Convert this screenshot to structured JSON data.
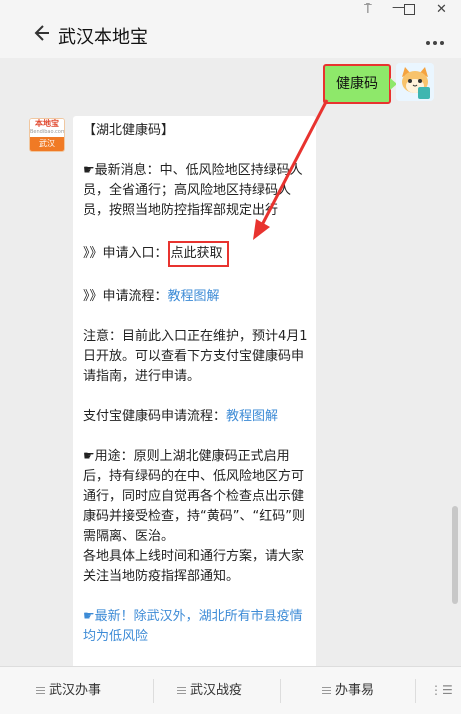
{
  "window": {
    "pin_glyph": "⍑",
    "min_glyph": "—",
    "close_glyph": "✕"
  },
  "header": {
    "back_icon": "back-arrow-icon",
    "title": "武汉本地宝",
    "more_icon": "more-dots-icon"
  },
  "chat": {
    "outgoing": {
      "text": "健康码"
    },
    "publisher_logo": {
      "top": "本地宝",
      "sub": "Bendibao.com",
      "bottom": "武汉"
    },
    "incoming": {
      "title": "【湖北健康码】",
      "news": "☛最新消息：中、低风险地区持绿码人员，全省通行；高风险地区持绿码人员，按照当地防控指挥部规定出行",
      "apply_prefix": "》》申请入口：",
      "apply_link": "点此获取",
      "process_prefix": "》》申请流程：",
      "process_link": "教程图解",
      "notice": "注意：目前此入口正在维护，预计4月1日开放。可以查看下方支付宝健康码申请指南，进行申请。",
      "alipay_prefix": "支付宝健康码申请流程：",
      "alipay_link": "教程图解",
      "usage": "☛用途：原则上湖北健康码正式启用后，持有绿码的在中、低风险地区方可通行，同时应自觉再各个检查点出示健康码并接受检查，持“黄码”、“红码”则需隔离、医治。",
      "schedule": "各地具体上线时间和通行方案，请大家关注当地防疫指挥部通知。",
      "latest_link": "☛最新！除武汉外，湖北所有市县疫情均为低风险",
      "tail": "【"
    }
  },
  "bottom_menu": {
    "items": [
      "武汉办事",
      "武汉战疫",
      "办事易"
    ],
    "keyboard_icon": "keyboard-toggle-icon",
    "keyboard_glyph": "⋮☰"
  },
  "colors": {
    "bubble_green": "#8ee86a",
    "annotation_red": "#e8332f",
    "link_blue": "#3d8bd6",
    "background": "#ededed"
  }
}
